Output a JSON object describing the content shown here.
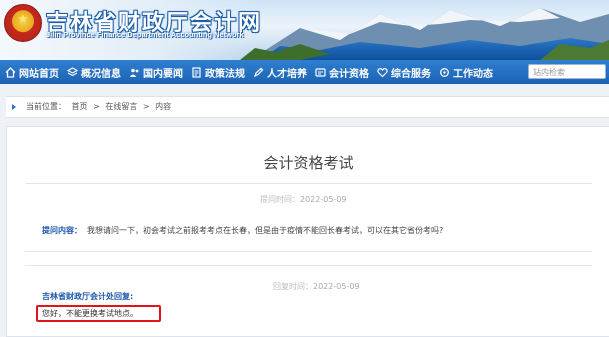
{
  "header": {
    "title": "吉林省财政厅会计网",
    "subtitle": "Jilin Province Finance Department Accounting Network",
    "emblem_icon": "national-emblem-icon"
  },
  "nav": {
    "items": [
      {
        "label": "网站首页",
        "icon": "home-icon"
      },
      {
        "label": "概况信息",
        "icon": "layers-icon"
      },
      {
        "label": "国内要闻",
        "icon": "users-icon"
      },
      {
        "label": "政策法规",
        "icon": "document-icon"
      },
      {
        "label": "人才培养",
        "icon": "pen-icon"
      },
      {
        "label": "会计资格",
        "icon": "card-icon"
      },
      {
        "label": "综合服务",
        "icon": "heart-icon"
      },
      {
        "label": "工作动态",
        "icon": "refresh-icon"
      }
    ],
    "search_placeholder": "站内检索"
  },
  "breadcrumb": {
    "prefix": "当前位置：",
    "items": [
      "首页",
      ">",
      "在线留言",
      ">",
      "内容"
    ]
  },
  "article": {
    "title": "会计资格考试",
    "question_time_label": "提问时间：",
    "question_time": "2022-05-09",
    "question_label": "提问内容：",
    "question_text": "我想请问一下，初会考试之前报考考点在长春，但是由于疫情不能回长春考试，可以在其它省份考吗?",
    "reply_time_label": "回复时间：",
    "reply_time": "2022-05-09",
    "reply_from": "吉林省财政厅会计处回复:",
    "reply_text": "您好，不能更换考试地点。"
  },
  "colors": {
    "nav_blue": "#1d63b4",
    "label_blue": "#1d57a8",
    "highlight_red": "#e0141a"
  }
}
